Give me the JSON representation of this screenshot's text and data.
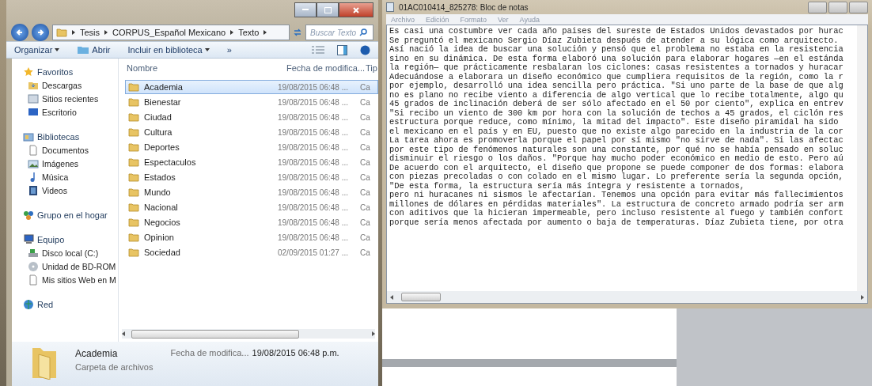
{
  "explorer": {
    "breadcrumb": [
      "Tesis",
      "CORPUS_Español Mexicano",
      "Texto"
    ],
    "search": {
      "placeholder": "Buscar Texto"
    },
    "toolbar": [
      {
        "kind": "menu",
        "label": "Organizar"
      },
      {
        "kind": "open",
        "label": "Abrir"
      },
      {
        "kind": "menu",
        "label": "Incluir en biblioteca"
      },
      {
        "kind": "more",
        "label": "»"
      }
    ],
    "nav": [
      {
        "kind": "star",
        "label": "Favoritos",
        "children": [
          {
            "kind": "download",
            "label": "Descargas"
          },
          {
            "kind": "recent",
            "label": "Sitios recientes"
          },
          {
            "kind": "desktop",
            "label": "Escritorio"
          }
        ]
      },
      {
        "kind": "library",
        "label": "Bibliotecas",
        "children": [
          {
            "kind": "document",
            "label": "Documentos"
          },
          {
            "kind": "image",
            "label": "Imágenes"
          },
          {
            "kind": "music",
            "label": "Música"
          },
          {
            "kind": "video",
            "label": "Videos"
          }
        ]
      },
      {
        "kind": "homegroup",
        "label": "Grupo en el hogar"
      },
      {
        "kind": "computer",
        "label": "Equipo",
        "children": [
          {
            "kind": "disk",
            "label": "Disco local (C:)"
          },
          {
            "kind": "drive",
            "label": "Unidad de BD-ROM"
          },
          {
            "kind": "file",
            "label": "Mis sitios Web en M"
          }
        ]
      },
      {
        "kind": "network",
        "label": "Red"
      }
    ],
    "columns": [
      "Nombre",
      "Fecha de modifica...",
      "Tip"
    ],
    "rows": [
      {
        "name": "Academia",
        "date": "19/08/2015 06:48 ...",
        "type": "Ca",
        "selected": true
      },
      {
        "name": "Bienestar",
        "date": "19/08/2015 06:48 ...",
        "type": "Ca",
        "selected": false
      },
      {
        "name": "Ciudad",
        "date": "19/08/2015 06:48 ...",
        "type": "Ca",
        "selected": false
      },
      {
        "name": "Cultura",
        "date": "19/08/2015 06:48 ...",
        "type": "Ca",
        "selected": false
      },
      {
        "name": "Deportes",
        "date": "19/08/2015 06:48 ...",
        "type": "Ca",
        "selected": false
      },
      {
        "name": "Espectaculos",
        "date": "19/08/2015 06:48 ...",
        "type": "Ca",
        "selected": false
      },
      {
        "name": "Estados",
        "date": "19/08/2015 06:48 ...",
        "type": "Ca",
        "selected": false
      },
      {
        "name": "Mundo",
        "date": "19/08/2015 06:48 ...",
        "type": "Ca",
        "selected": false
      },
      {
        "name": "Nacional",
        "date": "19/08/2015 06:48 ...",
        "type": "Ca",
        "selected": false
      },
      {
        "name": "Negocios",
        "date": "19/08/2015 06:48 ...",
        "type": "Ca",
        "selected": false
      },
      {
        "name": "Opinion",
        "date": "19/08/2015 06:48 ...",
        "type": "Ca",
        "selected": false
      },
      {
        "name": "Sociedad",
        "date": "02/09/2015 01:27 ...",
        "type": "Ca",
        "selected": false
      }
    ],
    "details": {
      "name": "Academia",
      "type": "Carpeta de archivos",
      "date_label": "Fecha de modifica...",
      "date_value": "19/08/2015 06:48 p.m."
    }
  },
  "notepad": {
    "title": "01AC010414_825278: Bloc de notas",
    "menu": [
      "Archivo",
      "Edición",
      "Formato",
      "Ver",
      "Ayuda"
    ],
    "lines": [
      "Es casi una costumbre ver cada año paises del sureste de Estados Unidos devastados por hurac",
      "Se preguntó el mexicano Sergio Díaz Zubieta después de atender a su lógica como arquitecto.",
      "Así nació la idea de buscar una solución y pensó que el problema no estaba en la resistencia",
      "sino en su dinámica. De esta forma elaboró una solución para elaborar hogares —en el estánda",
      "la región— que prácticamente resbalaran los ciclones: casas resistentes a tornados y huracar",
      "Adecuándose a elaborara un diseño económico que cumpliera requisitos de la región, como la r",
      "por ejemplo, desarrolló una idea sencilla pero práctica. \"Si uno parte de la base de que alg",
      "no es plano no recibe viento a diferencia de algo vertical que lo recibe totalmente, algo qu",
      "45 grados de inclinación deberá de ser sólo afectado en el 50 por ciento\", explica en entrev",
      "\"Si recibo un viento de 300 km por hora con la solución de techos a 45 grados, el ciclón res",
      "estructura porque reduce, como mínimo, la mitad del impacto\". Este diseño piramidal ha sido",
      "el mexicano en el país y en EU, puesto que no existe algo parecido en la industria de la cor",
      "La tarea ahora es promoverla porque el papel por sí mismo \"no sirve de nada\". Si las afectac",
      "por este tipo de fenómenos naturales son una constante, por qué no se había pensado en soluc",
      "disminuir el riesgo o los daños. \"Porque hay mucho poder económico en medio de esto. Pero aú",
      "De acuerdo con el arquitecto, el diseño que propone se puede componer de dos formas: elabora",
      "con piezas precoladas o con colado en el mismo lugar. Lo preferente sería la segunda opción,",
      "\"De esta forma, la estructura sería más íntegra y resistente a tornados,",
      "pero ni huracanes ni sismos le afectarían. Tenemos una opción para evitar más fallecimientos",
      "millones de dólares en pérdidas materiales\". La estructura de concreto armado podría ser arm",
      "con aditivos que la hicieran impermeable, pero incluso resistente al fuego y también confort",
      "porque sería menos afectada por aumento o baja de temperaturas. Díaz Zubieta tiene, por otra"
    ]
  }
}
